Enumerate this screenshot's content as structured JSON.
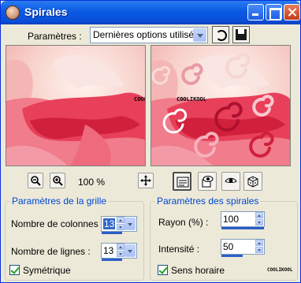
{
  "window": {
    "title": "Spirales"
  },
  "toolbar": {
    "params_label": "Paramètres :",
    "preset_value": "Dernières options utilisées"
  },
  "preview": {
    "watermark_before": "COOLIKOOL",
    "watermark_after": "COOLIKOOL"
  },
  "zoom": {
    "value": "100 %"
  },
  "grid_group": {
    "title": "Paramètres de la grille",
    "columns_label": "Nombre de colonnes :",
    "columns_value": "13",
    "columns_fraction": 0.9,
    "rows_label": "Nombre de lignes :",
    "rows_value": "13",
    "rows_fraction": 0.9,
    "symmetric_label": "Symétrique",
    "symmetric_checked": true
  },
  "spiral_group": {
    "title": "Paramètres des spirales",
    "radius_label": "Rayon (%) :",
    "radius_value": "100",
    "radius_fraction": 1.0,
    "intensity_label": "Intensité :",
    "intensity_value": "50",
    "intensity_fraction": 0.5,
    "clockwise_label": "Sens horaire",
    "clockwise_checked": true
  },
  "footer": {
    "watermark": "COOLIKOOL"
  },
  "colors": {
    "title_bar": "#0a5ae4",
    "legend": "#0046d5",
    "close_button": "#c23a1a",
    "flower": "#e8405a"
  },
  "icons": [
    "app-icon",
    "minimize-icon",
    "maximize-icon",
    "close-icon",
    "reset-icon",
    "save-icon",
    "zoom-out-icon",
    "zoom-in-icon",
    "pan-icon",
    "proof-icon",
    "auto-proof-icon",
    "eye-icon",
    "dice-icon"
  ]
}
